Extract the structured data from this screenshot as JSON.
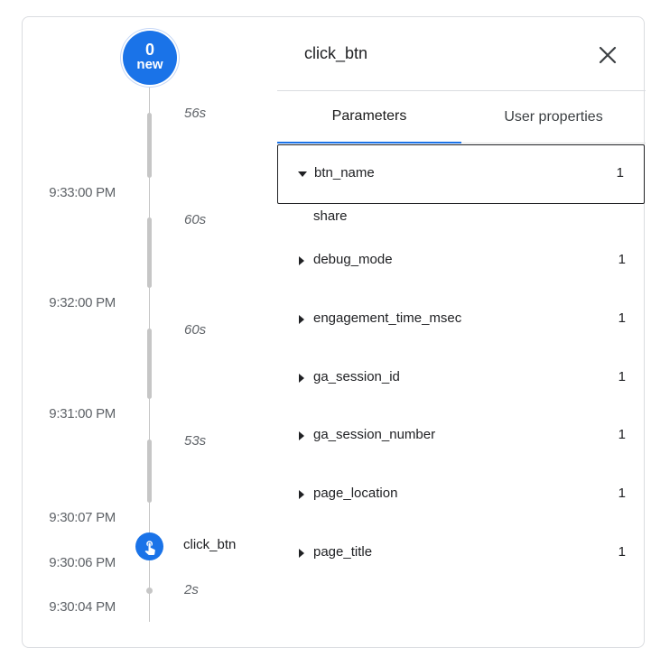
{
  "timeline": {
    "new_badge": {
      "count": "0",
      "label": "new"
    },
    "times": [
      "9:33:00 PM",
      "9:32:00 PM",
      "9:31:00 PM",
      "9:30:07 PM",
      "9:30:06 PM",
      "9:30:04 PM"
    ],
    "durations": [
      "56s",
      "60s",
      "60s",
      "53s",
      "2s"
    ],
    "event": {
      "label": "click_btn",
      "icon": "touch-icon"
    }
  },
  "panel": {
    "title": "click_btn",
    "close_icon": "close-icon",
    "tabs": [
      {
        "label": "Parameters",
        "active": true
      },
      {
        "label": "User properties",
        "active": false
      }
    ],
    "params": [
      {
        "name": "btn_name",
        "count": "1",
        "expanded": true,
        "value": "share"
      },
      {
        "name": "debug_mode",
        "count": "1",
        "expanded": false
      },
      {
        "name": "engagement_time_msec",
        "count": "1",
        "expanded": false
      },
      {
        "name": "ga_session_id",
        "count": "1",
        "expanded": false
      },
      {
        "name": "ga_session_number",
        "count": "1",
        "expanded": false
      },
      {
        "name": "page_location",
        "count": "1",
        "expanded": false
      },
      {
        "name": "page_title",
        "count": "1",
        "expanded": false
      }
    ]
  },
  "colors": {
    "accent": "#1a73e8",
    "line": "#c6c6c6",
    "muted_text": "#5f6368"
  }
}
